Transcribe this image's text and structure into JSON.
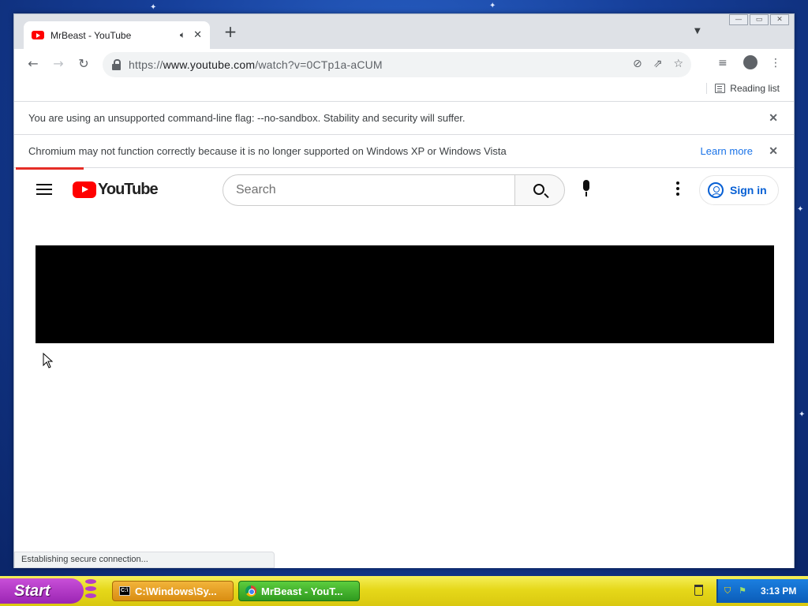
{
  "browser": {
    "tab": {
      "title": "MrBeast - YouTube"
    },
    "window_controls": {
      "minimize": "—",
      "restore": "▭",
      "close": "✕"
    },
    "address": {
      "scheme": "https://",
      "host": "www.youtube.com",
      "path": "/watch?v=0CTp1a-aCUM"
    },
    "reading_list_label": "Reading list",
    "infobars": [
      {
        "text": "You are using an unsupported command-line flag: --no-sandbox. Stability and security will suffer.",
        "link": ""
      },
      {
        "text": "Chromium may not function correctly because it is no longer supported on Windows XP or Windows Vista",
        "link": "Learn more"
      }
    ],
    "status_text": "Establishing secure connection..."
  },
  "youtube": {
    "logo_text": "YouTube",
    "search_placeholder": "Search",
    "sign_in_label": "Sign in"
  },
  "taskbar": {
    "start_label": "Start",
    "tasks": [
      {
        "label": "C:\\Windows\\Sy..."
      },
      {
        "label": "MrBeast - YouT..."
      }
    ],
    "clock": "3:13 PM"
  },
  "colors": {
    "youtube_red": "#ff0000",
    "link_blue": "#1a73e8",
    "signin_blue": "#065fd4",
    "loading_bar": "#e52d27",
    "taskbar_yellow": "#e6d81a"
  }
}
